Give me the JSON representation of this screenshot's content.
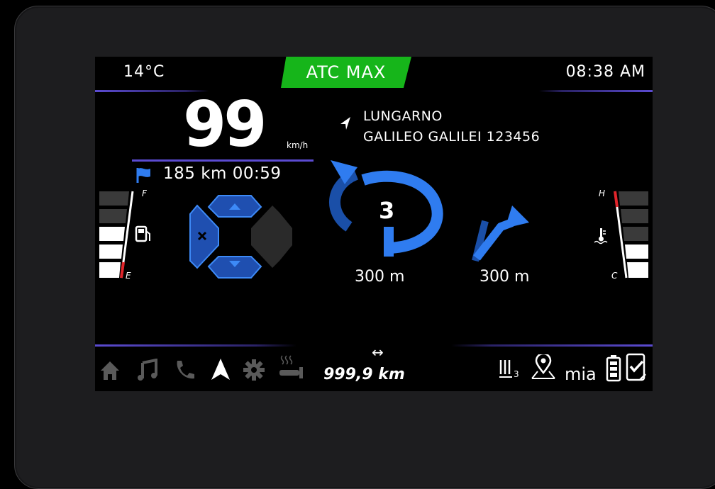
{
  "top_bar": {
    "temperature": "14°C",
    "atc_label": "ATC MAX",
    "time": "08:38 AM"
  },
  "speed": {
    "value": "99",
    "unit": "km/h"
  },
  "trip": {
    "remaining": "185 km 00:59"
  },
  "navigation": {
    "street_line1": "LUNGARNO",
    "street_line2": "GALILEO GALILEI 123456",
    "roundabout_exit": "3",
    "roundabout_distance": "300 m",
    "next_turn_distance": "300 m"
  },
  "fuel_gauge": {
    "label_full": "F",
    "label_empty": "E",
    "filled_segments": 3,
    "total_segments": 5
  },
  "temp_gauge": {
    "label_hot": "H",
    "label_cold": "C",
    "filled_segments": 2,
    "total_segments": 5
  },
  "bottom_bar": {
    "odometer": "999,9 km",
    "brand_text": "mia",
    "menu_icons": [
      "home-icon",
      "music-icon",
      "phone-icon",
      "navigation-arrow-icon",
      "settings-icon",
      "heated-grip-icon"
    ],
    "status_icons": [
      "heated-grip-level-3-icon",
      "map-pin-icon",
      "mia-logo",
      "battery-icon",
      "phone-connected-icon"
    ]
  },
  "colors": {
    "accent_blue": "#2f7cf0",
    "atc_green": "#16b51a",
    "divider_purple": "#5b4bd1",
    "gauge_red": "#e0242a"
  }
}
